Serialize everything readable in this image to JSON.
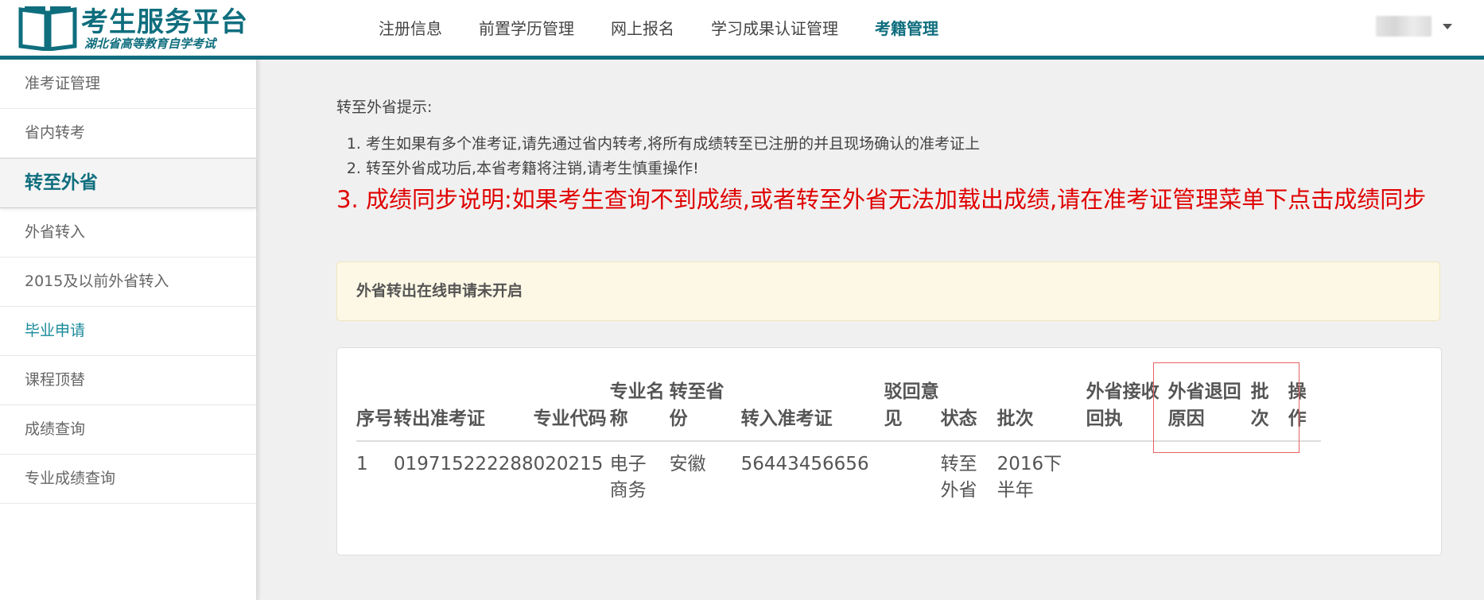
{
  "header": {
    "logo_title": "考生服务平台",
    "logo_subtitle": "湖北省高等教育自学考试",
    "nav": [
      "注册信息",
      "前置学历管理",
      "网上报名",
      "学习成果认证管理",
      "考籍管理"
    ],
    "active_nav": "考籍管理",
    "brand_color": "#0f6e7e"
  },
  "sidebar": {
    "items": [
      "准考证管理",
      "省内转考",
      "转至外省",
      "外省转入",
      "2015及以前外省转入",
      "毕业申请",
      "课程顶替",
      "成绩查询",
      "专业成绩查询"
    ],
    "active_item": "转至外省"
  },
  "hint": {
    "title": "转至外省提示:",
    "items": [
      "考生如果有多个准考证,请先通过省内转考,将所有成绩转至已注册的并且现场确认的准考证上",
      "转至外省成功后,本省考籍将注销,请考生慎重操作!",
      "成绩同步说明:如果考生查询不到成绩,或者转至外省无法加载出成绩,请在准考证管理菜单下点击成绩同步"
    ],
    "warning_color": "#e00000"
  },
  "alert": {
    "text": "外省转出在线申请未开启"
  },
  "table": {
    "headers": [
      "序号",
      "转出准考证",
      "专业代码",
      "专业名称",
      "转至省份",
      "转入准考证",
      "驳回意见",
      "状态",
      "批次",
      "外省接收回执",
      "外省退回原因",
      "批次",
      "操作"
    ],
    "rows": [
      [
        "1",
        "019715222288",
        "020215",
        "电子商务",
        "安徽",
        "56443456656",
        "",
        "转至外省",
        "2016下半年",
        "",
        "",
        "",
        ""
      ]
    ]
  }
}
